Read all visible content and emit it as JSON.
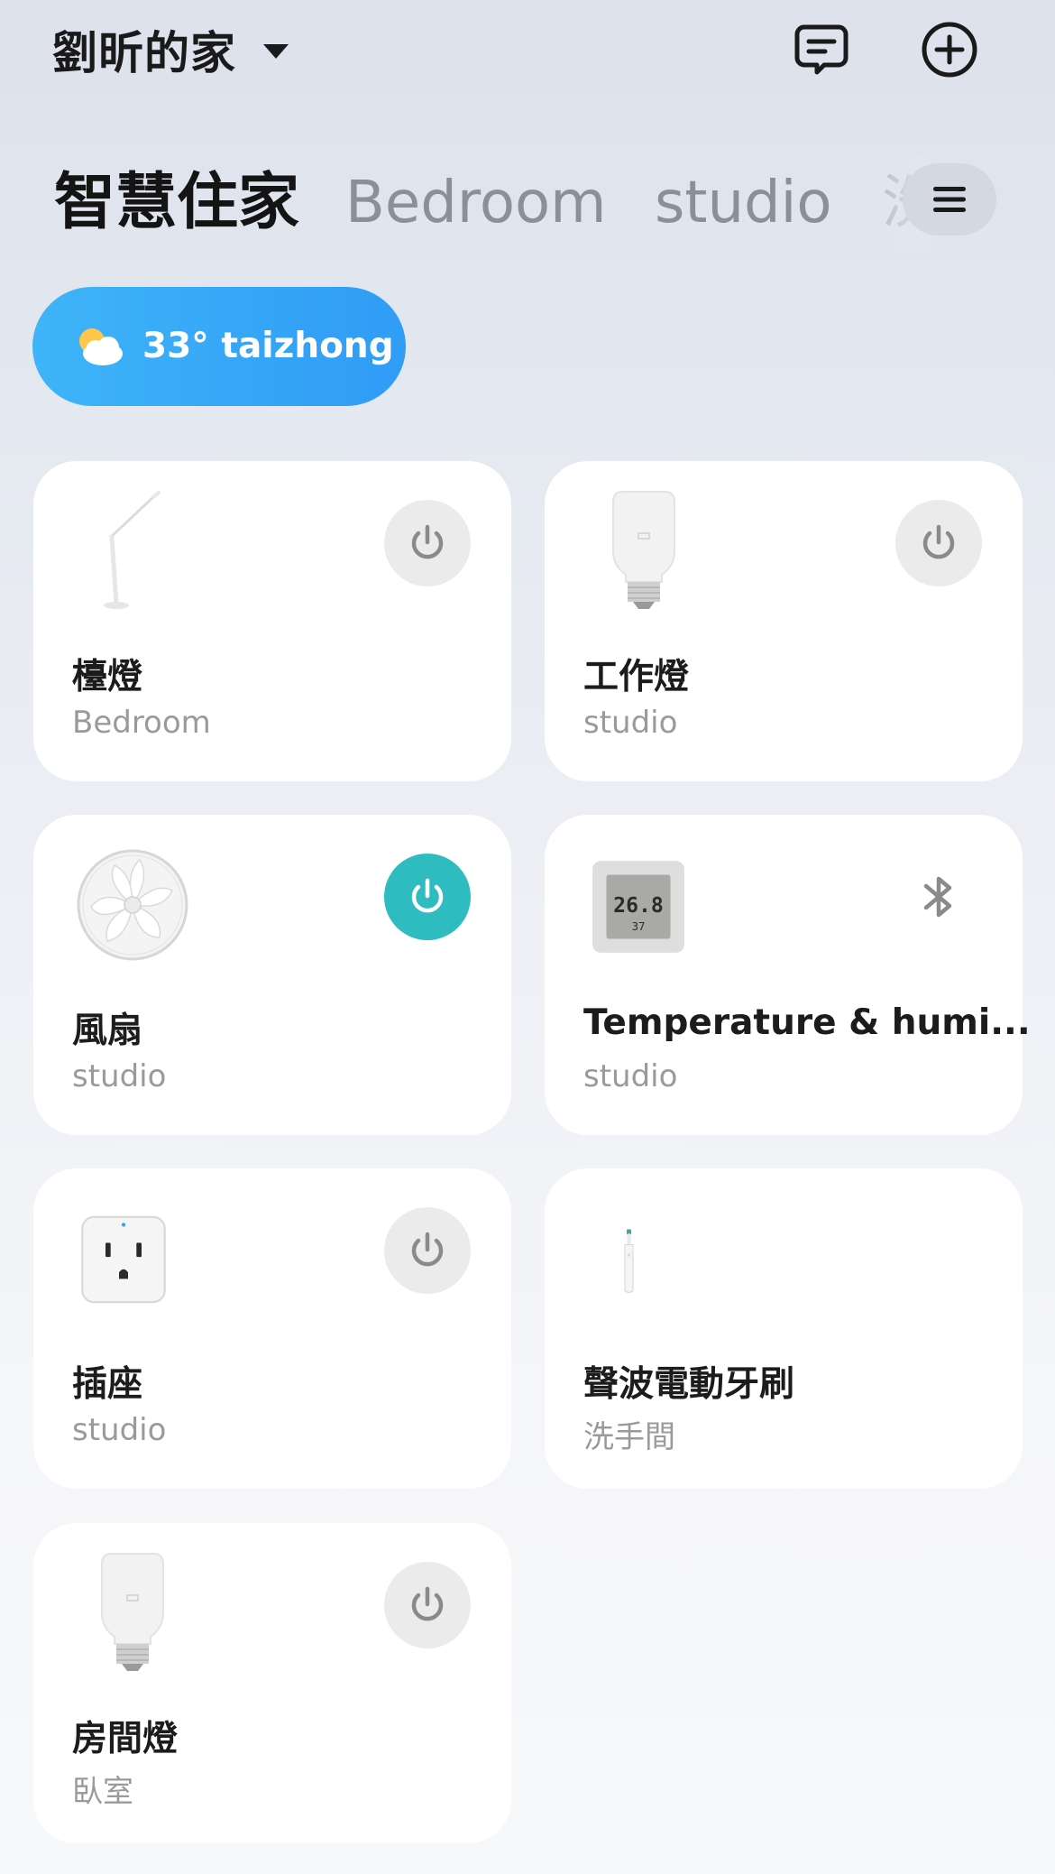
{
  "header": {
    "home_name": "劉昕的家",
    "messages_icon": "message-icon",
    "add_icon": "add-circle-icon"
  },
  "tabs": [
    {
      "label": "智慧住家",
      "active": true
    },
    {
      "label": "Bedroom",
      "active": false
    },
    {
      "label": "studio",
      "active": false
    },
    {
      "label": "洗",
      "active": false
    }
  ],
  "tab_menu_icon": "hamburger-menu-icon",
  "weather": {
    "icon": "partly-cloudy-icon",
    "text": "33° taizhong"
  },
  "colors": {
    "accent_on": "#2fbcc0",
    "weather_pill": "#3fb4f8",
    "power_off_bg": "#ebebeb"
  },
  "devices": [
    {
      "name": "檯燈",
      "room": "Bedroom",
      "icon": "desk-lamp-icon",
      "control": "power",
      "state": "off"
    },
    {
      "name": "工作燈",
      "room": "studio",
      "icon": "light-bulb-icon",
      "control": "power",
      "state": "off"
    },
    {
      "name": "風扇",
      "room": "studio",
      "icon": "fan-icon",
      "control": "power",
      "state": "on"
    },
    {
      "name": "Temperature & humi...",
      "room": "studio",
      "icon": "thermometer-hygrometer-icon",
      "control": "bluetooth",
      "state": "bluetooth"
    },
    {
      "name": "插座",
      "room": "studio",
      "icon": "smart-plug-icon",
      "control": "power",
      "state": "off"
    },
    {
      "name": "聲波電動牙刷",
      "room": "洗手間",
      "icon": "toothbrush-icon",
      "control": "none",
      "state": "none"
    },
    {
      "name": "房間燈",
      "room": "臥室",
      "icon": "light-bulb-icon",
      "control": "power",
      "state": "off"
    }
  ],
  "thermometer_display": {
    "temperature": "26.8",
    "humidity": "37"
  }
}
